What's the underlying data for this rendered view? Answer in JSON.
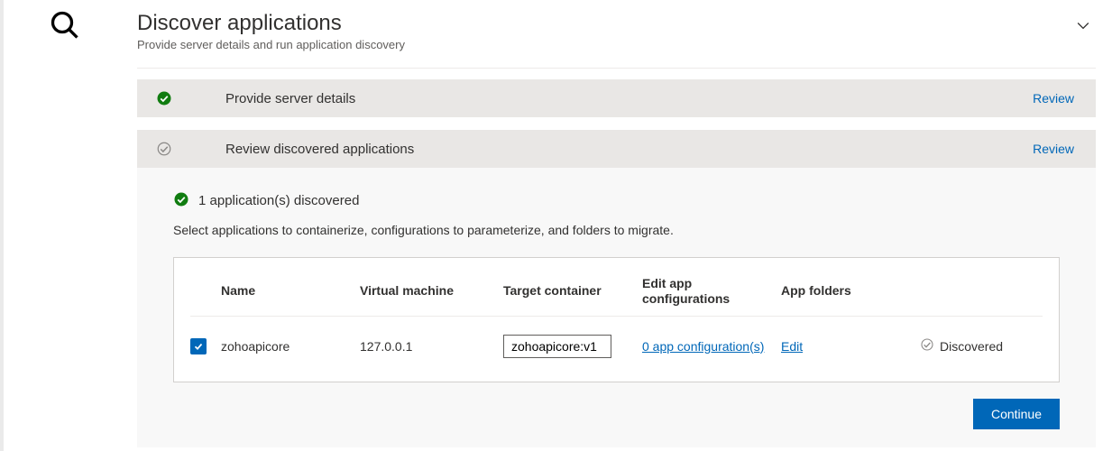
{
  "header": {
    "title": "Discover applications",
    "subtitle": "Provide server details and run application discovery"
  },
  "steps": [
    {
      "label": "Provide server details",
      "action": "Review",
      "status": "done"
    },
    {
      "label": "Review discovered applications",
      "action": "Review",
      "status": "pending"
    }
  ],
  "discovered": {
    "count_text": "1 application(s) discovered",
    "instruction": "Select applications to containerize, configurations to parameterize, and folders to migrate."
  },
  "table": {
    "headers": {
      "name": "Name",
      "vm": "Virtual machine",
      "target": "Target container",
      "editcfg": "Edit app configurations",
      "folders": "App folders",
      "status": ""
    },
    "row": {
      "name": "zohoapicore",
      "vm": "127.0.0.1",
      "target": "zohoapicore:v1",
      "editcfg": "0 app configuration(s)",
      "folders": "Edit",
      "status": "Discovered"
    }
  },
  "footer": {
    "continue": "Continue"
  }
}
